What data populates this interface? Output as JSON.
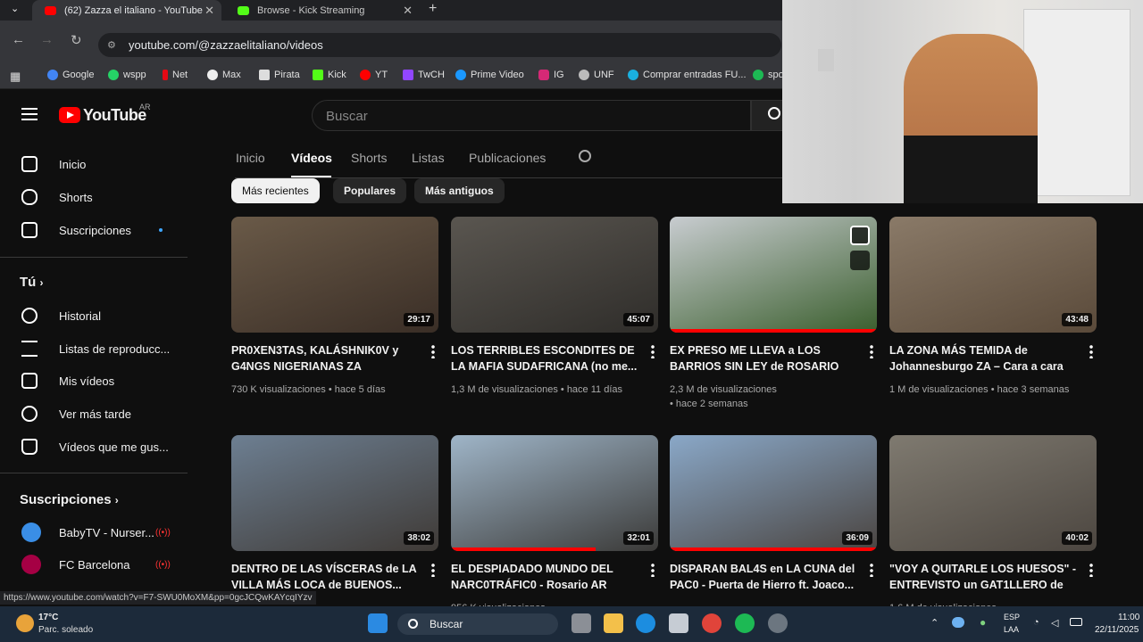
{
  "tabs": [
    {
      "title": "(62) Zazza el italiano - YouTube",
      "active": true
    },
    {
      "title": "Browse - Kick Streaming",
      "active": false
    }
  ],
  "address": {
    "url": "youtube.com/@zazzaelitaliano/videos"
  },
  "bookmarks": [
    "Google",
    "wspp",
    "Net",
    "Max",
    "Pirata",
    "Kick",
    "YT",
    "TwCH",
    "Prime Video",
    "IG",
    "UNF",
    "Comprar entradas FU...",
    "spo"
  ],
  "youtube": {
    "logo": "YouTube",
    "country": "AR",
    "search_placeholder": "Buscar",
    "sidebar": {
      "main": [
        "Inicio",
        "Shorts",
        "Suscripciones"
      ],
      "you_header": "Tú",
      "you": [
        "Historial",
        "Listas de reproducc...",
        "Mis vídeos",
        "Ver más tarde",
        "Vídeos que me gus..."
      ],
      "subs_header": "Suscripciones",
      "subs": [
        "BabyTV - Nurser...",
        "FC Barcelona"
      ]
    },
    "channel_tabs": [
      "Inicio",
      "Vídeos",
      "Shorts",
      "Listas",
      "Publicaciones"
    ],
    "active_tab": "Vídeos",
    "chips": [
      "Más recientes",
      "Populares",
      "Más antiguos"
    ],
    "videos": [
      {
        "title": "PR0XEN3TAS, KALÁSHNIK0V y G4NGS NIGERIANAS ZA",
        "views": "730 K visualizaciones",
        "age": "hace 5 días",
        "duration": "29:17",
        "progress": 0
      },
      {
        "title": "LOS TERRIBLES ESCONDITES DE LA MAFIA SUDAFRICANA (no me...",
        "views": "1,3 M de visualizaciones",
        "age": "hace 11 días",
        "duration": "45:07",
        "progress": 0
      },
      {
        "title": "EX PRESO ME LLEVA a LOS BARRIOS SIN LEY de ROSARIO AR",
        "views": "2,3 M de visualizaciones",
        "age": "hace 2 semanas",
        "duration": "",
        "progress": 100
      },
      {
        "title": "LA ZONA MÁS TEMIDA de Johannesburgo ZA – Cara a cara c...",
        "views": "1 M de visualizaciones",
        "age": "hace 3 semanas",
        "duration": "43:48",
        "progress": 0
      },
      {
        "title": "DENTRO DE LAS VÍSCERAS de LA VILLA MÁS LOCA de BUENOS...",
        "views": "",
        "age": "",
        "duration": "38:02",
        "progress": 0
      },
      {
        "title": "EL DESPIADADO MUNDO DEL NARC0TRÁFIC0 - Rosario AR",
        "views": "956 K visualizaciones",
        "age": "",
        "duration": "32:01",
        "progress": 70
      },
      {
        "title": "DISPARAN BAL4S en LA CUNA del PAC0 - Puerta de Hierro ft. Joaco...",
        "views": "",
        "age": "",
        "duration": "36:09",
        "progress": 100
      },
      {
        "title": "\"VOY A QUITARLE LOS HUESOS\" - ENTREVISTO un GAT1LLERO de la...",
        "views": "1,6 M de visualizaciones",
        "age": "",
        "duration": "40:02",
        "progress": 0
      }
    ]
  },
  "status_url": "https://www.youtube.com/watch?v=F7-SWU0MoXM&pp=0gcJCQwKAYcqIYzv",
  "taskbar": {
    "temp": "17°C",
    "weather": "Parc. soleado",
    "search": "Buscar",
    "lang": "ESP",
    "lang2": "LAA",
    "time": "11:00",
    "date": "22/11/2025"
  }
}
